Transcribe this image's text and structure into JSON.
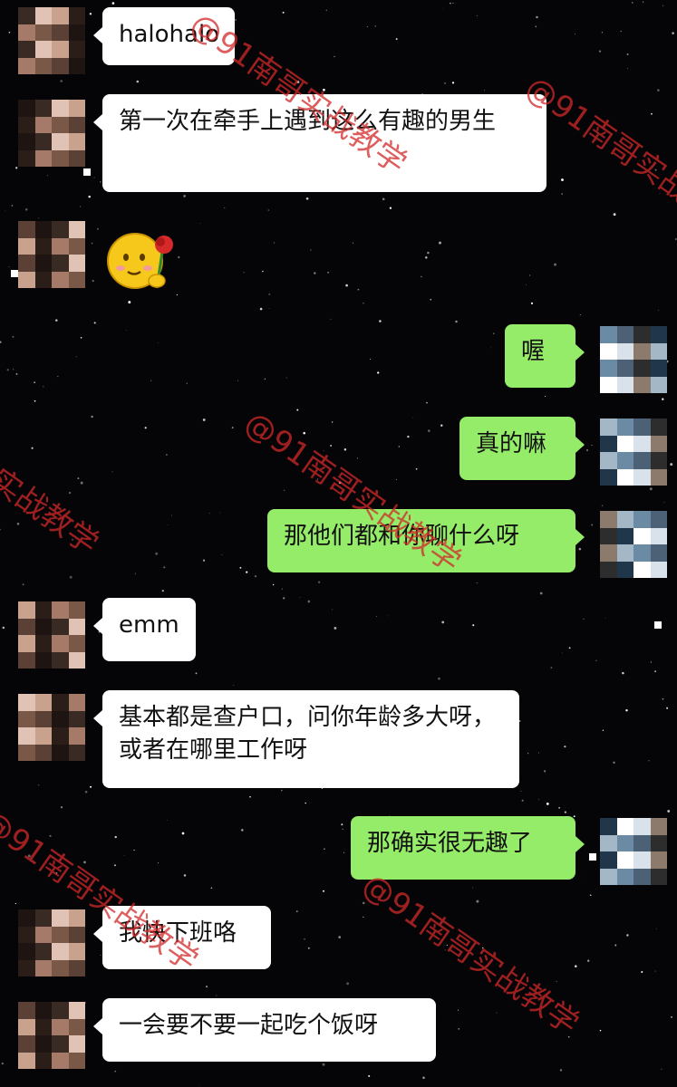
{
  "messages": [
    {
      "side": "left",
      "type": "text",
      "text": "halohalo"
    },
    {
      "side": "left",
      "type": "text",
      "text": "第一次在牵手上遇到这么有趣的男生"
    },
    {
      "side": "left",
      "type": "emoji",
      "icon": "smiley-holding-rose-icon"
    },
    {
      "side": "right",
      "type": "text",
      "text": "喔"
    },
    {
      "side": "right",
      "type": "text",
      "text": "真的嘛"
    },
    {
      "side": "right",
      "type": "text",
      "text": "那他们都和你聊什么呀"
    },
    {
      "side": "left",
      "type": "text",
      "text": "emm"
    },
    {
      "side": "left",
      "type": "text",
      "text": "基本都是查户口，问你年龄多大呀，或者在哪里工作呀"
    },
    {
      "side": "right",
      "type": "text",
      "text": "那确实很无趣了"
    },
    {
      "side": "left",
      "type": "text",
      "text": "我快下班咯"
    },
    {
      "side": "left",
      "type": "text",
      "text": "一会要不要一起吃个饭呀"
    }
  ],
  "watermark": {
    "text": "@91南哥实战教学",
    "color": "#d22828"
  },
  "colors": {
    "background": "#050507",
    "incoming_bubble": "#ffffff",
    "outgoing_bubble": "#95ec69"
  }
}
